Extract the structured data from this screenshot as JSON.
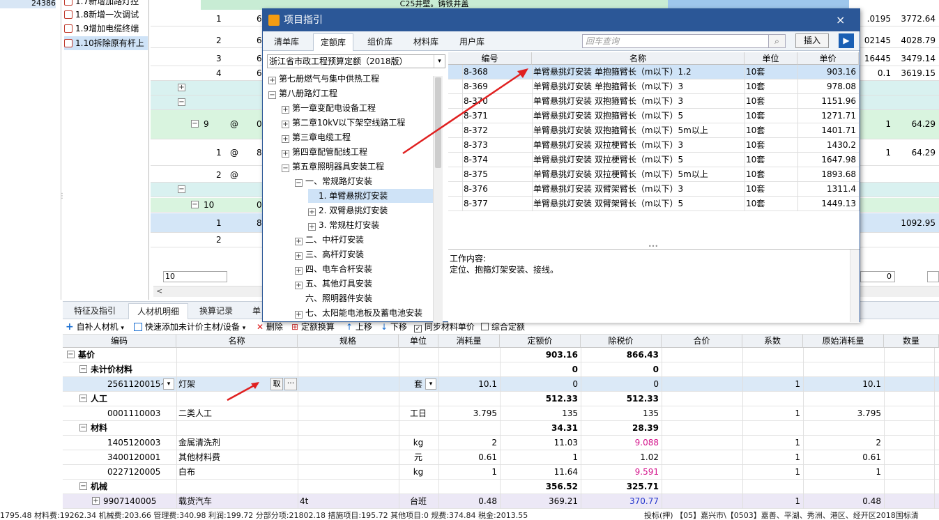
{
  "left_panel": {
    "value": "24386"
  },
  "nav": {
    "items": [
      {
        "label": "1.7新增加路灯控"
      },
      {
        "label": "1.8新增一次调试"
      },
      {
        "label": "1.9增加电缆终端"
      },
      {
        "label": "1.10拆除原有杆上"
      }
    ]
  },
  "top_grid": {
    "header_text": "C25井壁。铸铁井盖",
    "rows": [
      {
        "no": "1",
        "c2": "6",
        "v1": ".0195",
        "v2": "3772.64"
      },
      {
        "no": "2",
        "c2": "6",
        "v1": "02145",
        "v2": "4028.79"
      },
      {
        "no": "3",
        "c2": "6",
        "v1": "16445",
        "v2": "3479.14"
      },
      {
        "no": "4",
        "c2": "6",
        "v1": "0.1",
        "v2": "3619.15"
      },
      {
        "no": "9",
        "c2": "@",
        "c3": "0",
        "v1": "1",
        "v2": "64.29"
      },
      {
        "no": "1",
        "c2": "@",
        "c3": "8",
        "v1": "1",
        "v2": "64.29"
      },
      {
        "no": "2",
        "c2": "@"
      },
      {
        "no": "10",
        "c3": "0"
      },
      {
        "no": "1",
        "c3": "8",
        "v2": "1092.95"
      },
      {
        "no": "2"
      }
    ],
    "bottom_input": "10",
    "right_input": "0"
  },
  "bottom_tabs": [
    {
      "label": "特征及指引"
    },
    {
      "label": "人材机明细"
    },
    {
      "label": "换算记录"
    },
    {
      "label": "单"
    }
  ],
  "toolbar": {
    "add_material": "自补人材机",
    "quick_add": "快速添加未计价主材/设备",
    "delete": "删除",
    "quota_convert": "定额换算",
    "move_up": "上移",
    "move_down": "下移",
    "sync_price": "同步材料单价",
    "comprehensive": "综合定额"
  },
  "bottom_grid": {
    "headers": [
      "编码",
      "名称",
      "规格",
      "单位",
      "消耗量",
      "定额价",
      "除税价",
      "合价",
      "系数",
      "原始消耗量",
      "数量"
    ],
    "rows": [
      {
        "level": 0,
        "exp": "−",
        "code": "基价",
        "quota": "903.16",
        "tax": "866.43",
        "bold": true
      },
      {
        "level": 1,
        "exp": "−",
        "code": "未计价材料",
        "quota": "0",
        "tax": "0",
        "bold": true
      },
      {
        "level": 2,
        "code": "2561120015~1",
        "name": "灯架",
        "btn": "取",
        "unit": "套",
        "cons": "10.1",
        "quota": "0",
        "tax": "0",
        "coef": "1",
        "orig": "10.1",
        "selected": true
      },
      {
        "level": 1,
        "exp": "−",
        "code": "人工",
        "quota": "512.33",
        "tax": "512.33",
        "bold": true
      },
      {
        "level": 2,
        "code": "0001110003",
        "name": "二类人工",
        "unit": "工日",
        "cons": "3.795",
        "quota": "135",
        "tax": "135",
        "coef": "1",
        "orig": "3.795"
      },
      {
        "level": 1,
        "exp": "−",
        "code": "材料",
        "quota": "34.31",
        "tax": "28.39",
        "bold": true
      },
      {
        "level": 2,
        "code": "1405120003",
        "name": "金属清洗剂",
        "unit": "kg",
        "cons": "2",
        "quota": "11.03",
        "tax": "9.088",
        "taxcolor": "#d4148c",
        "coef": "1",
        "orig": "2"
      },
      {
        "level": 2,
        "code": "3400120001",
        "name": "其他材料费",
        "unit": "元",
        "cons": "0.61",
        "quota": "1",
        "tax": "1.02",
        "coef": "1",
        "orig": "0.61"
      },
      {
        "level": 2,
        "code": "0227120005",
        "name": "白布",
        "unit": "kg",
        "cons": "1",
        "quota": "11.64",
        "tax": "9.591",
        "taxcolor": "#d4148c",
        "coef": "1",
        "orig": "1"
      },
      {
        "level": 1,
        "exp": "−",
        "code": "机械",
        "quota": "356.52",
        "tax": "325.71",
        "bold": true
      },
      {
        "level": 2,
        "exp": "+",
        "code": "9907140005",
        "name": "载货汽车",
        "spec": "4t",
        "unit": "台班",
        "cons": "0.48",
        "quota": "369.21",
        "tax": "370.77",
        "taxcolor": "#2233cc",
        "coef": "1",
        "orig": "0.48",
        "purple": true
      }
    ]
  },
  "status_bar": {
    "left": "1795.48 材料费:19262.34 机械费:203.66 管理费:340.98 利润:199.72 分部分项:21802.18 措施项目:195.72 其他项目:0 规费:374.84 税金:2013.55",
    "right": "投标(押)     【05】嘉兴市\\【0503】嘉善、平湖、秀洲、港区、经开区2018国标清"
  },
  "dialog": {
    "title": "项目指引",
    "close": "×",
    "tabs": [
      {
        "label": "清单库"
      },
      {
        "label": "定额库"
      },
      {
        "label": "组价库"
      },
      {
        "label": "材料库"
      },
      {
        "label": "用户库"
      }
    ],
    "search_placeholder": "回车查询",
    "insert_label": "插入",
    "library_select": "浙江省市政工程预算定额（2018版）",
    "tree": [
      {
        "indent": 0,
        "exp": "+",
        "label": "第七册燃气与集中供热工程"
      },
      {
        "indent": 0,
        "exp": "−",
        "label": "第八册路灯工程"
      },
      {
        "indent": 1,
        "exp": "+",
        "label": "第一章变配电设备工程"
      },
      {
        "indent": 1,
        "exp": "+",
        "label": "第二章10kV以下架空线路工程"
      },
      {
        "indent": 1,
        "exp": "+",
        "label": "第三章电缆工程"
      },
      {
        "indent": 1,
        "exp": "+",
        "label": "第四章配管配线工程"
      },
      {
        "indent": 1,
        "exp": "−",
        "label": "第五章照明器具安装工程"
      },
      {
        "indent": 2,
        "exp": "−",
        "label": "一、常规路灯安装"
      },
      {
        "indent": 3,
        "exp": "",
        "label": "1. 单臂悬挑灯安装",
        "selected": true
      },
      {
        "indent": 3,
        "exp": "+",
        "label": "2. 双臂悬挑灯安装"
      },
      {
        "indent": 3,
        "exp": "+",
        "label": "3. 常规柱灯安装"
      },
      {
        "indent": 2,
        "exp": "+",
        "label": "二、中杆灯安装"
      },
      {
        "indent": 2,
        "exp": "+",
        "label": "三、高杆灯安装"
      },
      {
        "indent": 2,
        "exp": "+",
        "label": "四、电车合杆安装"
      },
      {
        "indent": 2,
        "exp": "+",
        "label": "五、其他灯具安装"
      },
      {
        "indent": 2,
        "exp": "",
        "label": "六、照明器件安装"
      },
      {
        "indent": 2,
        "exp": "+",
        "label": "七、太阳能电池板及蓄电池安装"
      }
    ],
    "grid_headers": [
      "编号",
      "名称",
      "单位",
      "单价"
    ],
    "grid_rows": [
      {
        "code": "8-368",
        "name": "单臂悬挑灯安装 单抱箍臂长（m以下）1.2",
        "unit": "10套",
        "price": "903.16",
        "selected": true
      },
      {
        "code": "8-369",
        "name": "单臂悬挑灯安装 单抱箍臂长（m以下）3",
        "unit": "10套",
        "price": "978.08"
      },
      {
        "code": "8-370",
        "name": "单臂悬挑灯安装 双抱箍臂长（m以下）3",
        "unit": "10套",
        "price": "1151.96"
      },
      {
        "code": "8-371",
        "name": "单臂悬挑灯安装 双抱箍臂长（m以下）5",
        "unit": "10套",
        "price": "1271.71"
      },
      {
        "code": "8-372",
        "name": "单臂悬挑灯安装 双抱箍臂长（m以下）5m以上",
        "unit": "10套",
        "price": "1401.71"
      },
      {
        "code": "8-373",
        "name": "单臂悬挑灯安装 双拉梗臂长（m以下）3",
        "unit": "10套",
        "price": "1430.2"
      },
      {
        "code": "8-374",
        "name": "单臂悬挑灯安装 双拉梗臂长（m以下）5",
        "unit": "10套",
        "price": "1647.98"
      },
      {
        "code": "8-375",
        "name": "单臂悬挑灯安装 双拉梗臂长（m以下）5m以上",
        "unit": "10套",
        "price": "1893.68"
      },
      {
        "code": "8-376",
        "name": "单臂悬挑灯安装 双臂架臂长（m以下）3",
        "unit": "10套",
        "price": "1311.4"
      },
      {
        "code": "8-377",
        "name": "单臂悬挑灯安装 双臂架臂长（m以下）5",
        "unit": "10套",
        "price": "1449.13"
      }
    ],
    "work_content_label": "工作内容:",
    "work_content": "定位、抱箍灯架安装、接线。"
  }
}
